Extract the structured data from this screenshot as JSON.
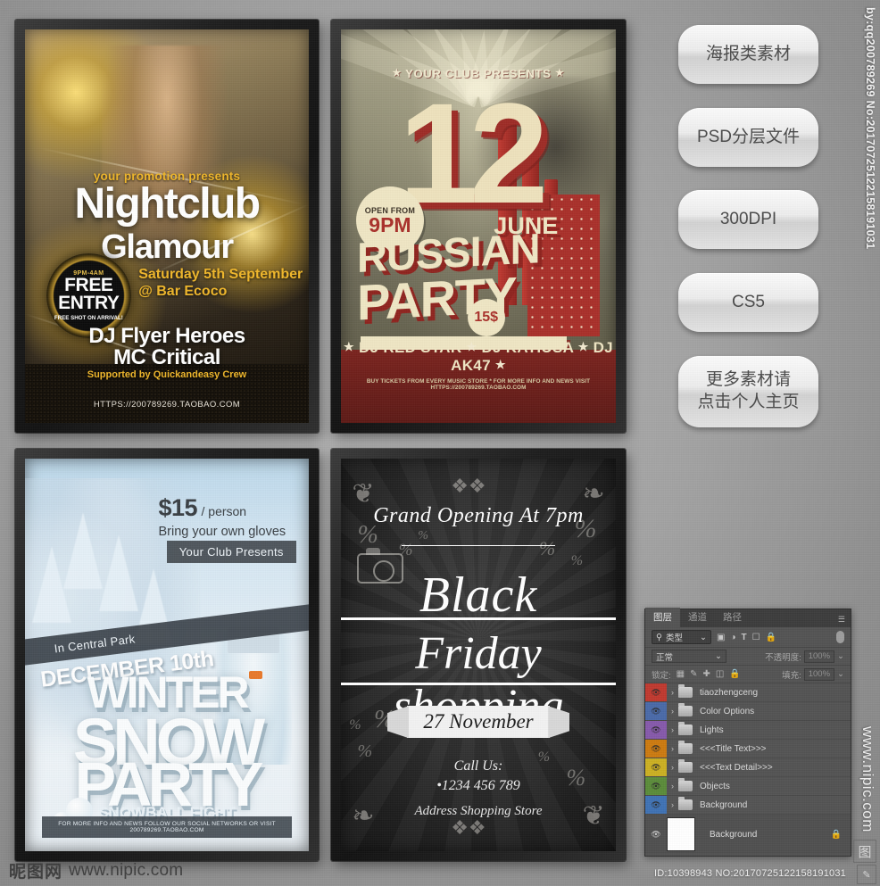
{
  "watermarks": {
    "vertical_top": "by:qq200789269 No:20170725122158191031",
    "vertical_bottom": "www.nipic.com",
    "logo_cn": "昵图网",
    "logo_domain": "www.nipic.com",
    "id_line": "ID:10398943 NO:20170725122158191031",
    "corner_glyph": "图",
    "corner_glyph2": "✎"
  },
  "buttons": [
    {
      "label": "海报类素材"
    },
    {
      "label": "PSD分层文件"
    },
    {
      "label": "300DPI"
    },
    {
      "label": "CS5"
    },
    {
      "label": "更多素材请\n点击个人主页"
    }
  ],
  "posters": {
    "nightclub": {
      "promo": "your promotion presents",
      "title1": "Nightclub",
      "title2": "Glamour",
      "badge_hours": "9PM-4AM",
      "badge_free": "FREE",
      "badge_entry": "ENTRY",
      "badge_sub": "FREE SHOT ON ARRIVAL!",
      "date_line1": "Saturday 5th September",
      "date_line2": "@ Bar Ecoco",
      "dj1": "DJ Flyer Heroes",
      "dj2": "MC Critical",
      "support": "Supported by Quickandeasy Crew",
      "url": "HTTPS://200789269.TAOBAO.COM"
    },
    "russian": {
      "presents": "YOUR CLUB PRESENTS",
      "star": "★",
      "big_number": "12",
      "month": "JUNE",
      "open_from": "OPEN FROM",
      "open_time": "9PM",
      "word1": "RUSSIAN",
      "word2": "PARTY",
      "price": "15$",
      "djs": "DJ RED STAR",
      "dj2": "DJ KATIUSA",
      "dj3": "DJ AK47",
      "fineprint": "BUY TICKETS FROM EVERY MUSIC STORE  *  FOR MORE INFO AND NEWS VISIT HTTPS://200789269.TAOBAO.COM"
    },
    "winter": {
      "price_amount": "$15",
      "price_per": "/ person",
      "gloves": "Bring your own gloves",
      "club_tag": "Your Club Presents",
      "location": "In Central Park",
      "date": "DECEMBER 10th",
      "word1": "WINTER",
      "word2": "SNOW",
      "word3": "PARTY",
      "subtitle": "SNOWBALL FIGHT",
      "footer": "FOR MORE INFO AND NEWS FOLLOW OUR SOCIAL NETWORKS OR VISIT 200789269.TAOBAO.COM"
    },
    "blackfriday": {
      "grand": "Grand Opening  At 7pm",
      "black": "Black",
      "friday": "Friday shopping",
      "date": "27  November",
      "call_label": "Call Us:",
      "phone": "•1234 456 789",
      "address": "Address Shopping Store",
      "percent": "%"
    }
  },
  "photoshop": {
    "tabs": [
      {
        "label": "图层",
        "active": true
      },
      {
        "label": "通道",
        "active": false
      },
      {
        "label": "路径",
        "active": false
      }
    ],
    "menu_glyph": "☰",
    "filter": {
      "search_glyph": "🔍",
      "kind_label": "类型",
      "chevron": "⌄",
      "icons": [
        "image-filter-icon",
        "adjustment-filter-icon",
        "type-filter-icon",
        "shape-filter-icon",
        "smart-object-filter-icon"
      ]
    },
    "blend": {
      "mode": "正常",
      "chevron": "⌄",
      "opacity_label": "不透明度:",
      "opacity_value": "100%"
    },
    "lock": {
      "label": "锁定:",
      "fill_label": "填充:",
      "fill_value": "100%"
    },
    "layers": [
      {
        "name": "tiaozhengceng",
        "color": "#c0392f",
        "visible": true
      },
      {
        "name": "Color Options",
        "color": "#4a6aa8",
        "visible": true
      },
      {
        "name": "Lights",
        "color": "#8659ab",
        "visible": true
      },
      {
        "name": "<<<Title Text>>>",
        "color": "#cc7a10",
        "visible": true
      },
      {
        "name": "<<<Text Detail>>>",
        "color": "#cbb022",
        "visible": true
      },
      {
        "name": "Objects",
        "color": "#5b8c3a",
        "visible": true
      },
      {
        "name": "Background",
        "color": "#3f72b4",
        "visible": true
      }
    ],
    "background_layer": {
      "name": "Background",
      "visible": true,
      "lock_glyph": "🔒"
    }
  }
}
